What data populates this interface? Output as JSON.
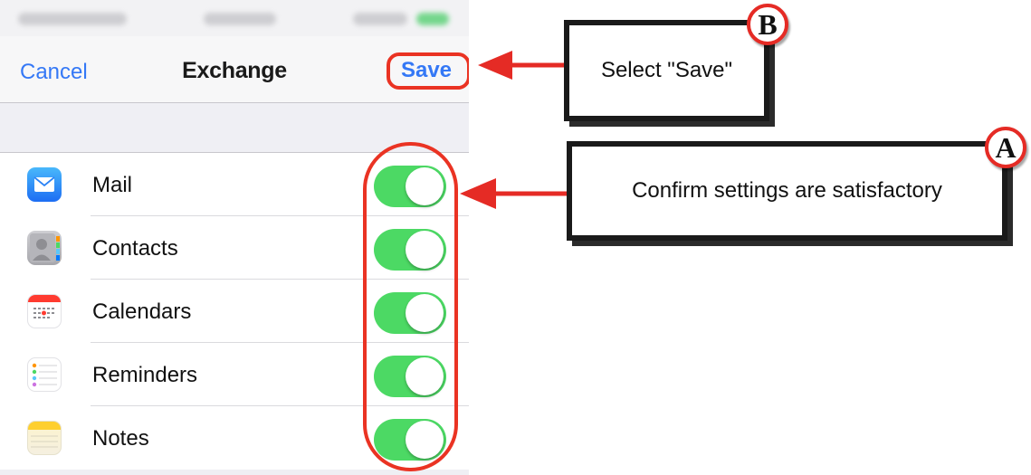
{
  "navbar": {
    "cancel_label": "Cancel",
    "title": "Exchange",
    "save_label": "Save"
  },
  "rows": [
    {
      "label": "Mail",
      "icon": "mail-icon",
      "toggle": "on"
    },
    {
      "label": "Contacts",
      "icon": "contacts-icon",
      "toggle": "on"
    },
    {
      "label": "Calendars",
      "icon": "calendar-icon",
      "toggle": "on"
    },
    {
      "label": "Reminders",
      "icon": "reminders-icon",
      "toggle": "on"
    },
    {
      "label": "Notes",
      "icon": "notes-icon",
      "toggle": "on"
    }
  ],
  "callouts": {
    "b": {
      "badge": "B",
      "text": "Select \"Save\""
    },
    "a": {
      "badge": "A",
      "text": "Confirm settings are satisfactory"
    }
  },
  "colors": {
    "ios_blue": "#3478f6",
    "toggle_green": "#4cd964",
    "highlight_red": "#ea3323"
  }
}
